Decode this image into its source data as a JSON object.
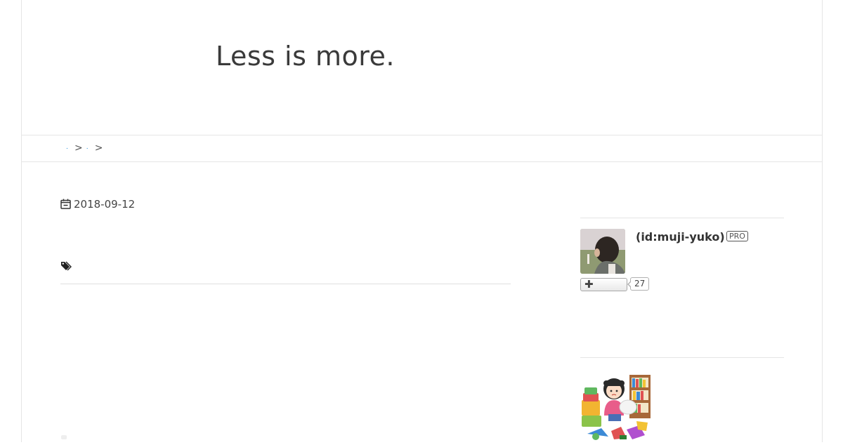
{
  "blog": {
    "title": "Less is more."
  },
  "breadcrumb": {
    "items": [
      ".",
      "."
    ],
    "separator": ">"
  },
  "entry": {
    "date": "2018-09-12",
    "date_icon": "calendar-icon",
    "tag_icon": "tag-icon"
  },
  "profile": {
    "id_label": "(id:muji-yuko)",
    "badge": "PRO",
    "subscribe_icon": "plus-icon",
    "subscriber_count": "27"
  },
  "colors": {
    "link": "#1a8ad9",
    "text": "#333333",
    "border": "#e5e5e5"
  }
}
